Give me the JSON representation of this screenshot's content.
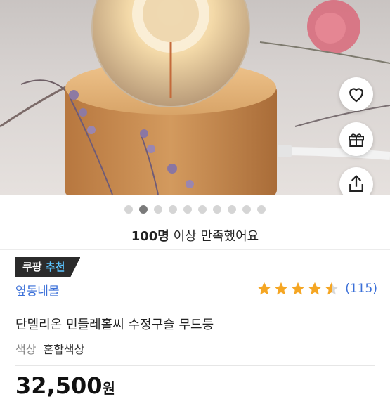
{
  "hero": {
    "image_description_icon": "product-photo"
  },
  "actions": {
    "wishlist_icon": "heart-icon",
    "gift_icon": "gift-icon",
    "share_icon": "share-icon"
  },
  "carousel": {
    "total": 10,
    "active_index": 1
  },
  "satisfaction": {
    "count": "100명",
    "suffix": " 이상 만족했어요"
  },
  "badge": {
    "part1": "쿠팡",
    "part2": "추천"
  },
  "seller": {
    "name": "옆동네몰"
  },
  "rating": {
    "stars": 4.5,
    "reviews": "(115)"
  },
  "product": {
    "title": "단델리온 민들레홀씨 수정구슬 무드등"
  },
  "option": {
    "label": "색상",
    "value": "혼합색상"
  },
  "price": {
    "amount": "32,500",
    "unit": "원"
  },
  "colors": {
    "star": "#f5a623",
    "link": "#3a6fd8",
    "badge_accent": "#5bc4ff"
  }
}
